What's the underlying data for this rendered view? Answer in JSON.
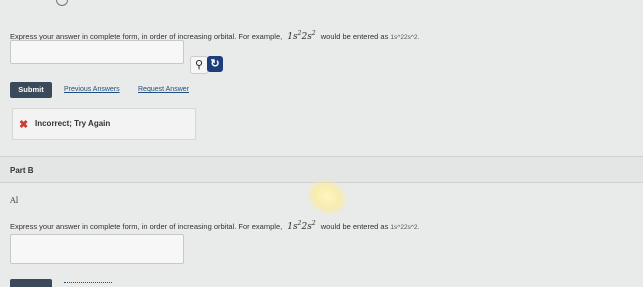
{
  "partA": {
    "instruction": "Express your answer in complete form, in order of increasing orbital. For example,",
    "example_base1": "1s",
    "example_exp1": "2",
    "example_base2": "2s",
    "example_exp2": "2",
    "instruction_mid": "would be entered as",
    "example_code": "1s^22s^2.",
    "answer_value": "",
    "submit_label": "Submit",
    "previous_answers": "Previous Answers",
    "request_answer": "Request Answer",
    "feedback_icon": "x-icon",
    "feedback_text": "Incorrect; Try Again"
  },
  "partB": {
    "label": "Part B",
    "symbol": "Al",
    "instruction": "Express your answer in complete form, in order of increasing orbital. For example,",
    "example_base1": "1s",
    "example_exp1": "2",
    "example_base2": "2s",
    "example_exp2": "2",
    "instruction_mid": "would be entered as",
    "example_code": "1s^22s^2.",
    "answer_value": ""
  },
  "colors": {
    "background": "#e9eaea",
    "submit_bg": "#3b4a5a",
    "error_red": "#d0392f",
    "link": "#1f4f7a"
  }
}
